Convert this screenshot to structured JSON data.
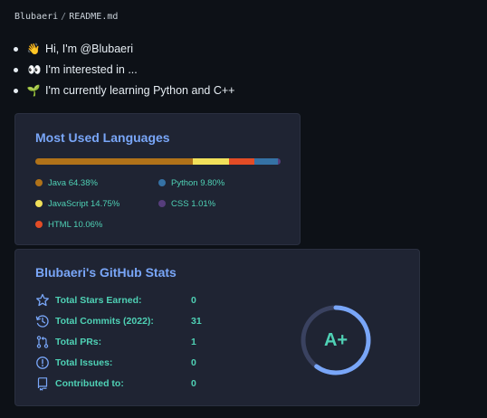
{
  "breadcrumb": {
    "user": "Blubaeri",
    "separator": "/",
    "file": "README.md"
  },
  "intro": [
    {
      "icon": "waving-hand-icon",
      "glyph": "👋",
      "text": "Hi, I'm @Blubaeri"
    },
    {
      "icon": "eyes-icon",
      "glyph": "👀",
      "text": "I'm interested in ..."
    },
    {
      "icon": "seedling-icon",
      "glyph": "🌱",
      "text": "I'm currently learning Python and C++"
    }
  ],
  "languages_card": {
    "title": "Most Used Languages",
    "languages": [
      {
        "name": "Java",
        "percent": "64.38%",
        "value": 64.38,
        "color": "#b07219"
      },
      {
        "name": "JavaScript",
        "percent": "14.75%",
        "value": 14.75,
        "color": "#f1e05a"
      },
      {
        "name": "HTML",
        "percent": "10.06%",
        "value": 10.06,
        "color": "#e34c26"
      },
      {
        "name": "Python",
        "percent": "9.80%",
        "value": 9.8,
        "color": "#3572a5"
      },
      {
        "name": "CSS",
        "percent": "1.01%",
        "value": 1.01,
        "color": "#563d7c"
      }
    ]
  },
  "stats_card": {
    "title": "Blubaeri's GitHub Stats",
    "rows": [
      {
        "icon": "star-icon",
        "label": "Total Stars Earned:",
        "value": "0"
      },
      {
        "icon": "history-clock-icon",
        "label": "Total Commits (2022):",
        "value": "31"
      },
      {
        "icon": "pull-request-icon",
        "label": "Total PRs:",
        "value": "1"
      },
      {
        "icon": "issue-icon",
        "label": "Total Issues:",
        "value": "0"
      },
      {
        "icon": "repo-icon",
        "label": "Contributed to:",
        "value": "0"
      }
    ],
    "rank": {
      "grade": "A+",
      "progress": 0.6
    }
  },
  "colors": {
    "background": "#0d1117",
    "card": "#1f2433",
    "title": "#79a6f8",
    "text_accent": "#4fd1b5"
  }
}
